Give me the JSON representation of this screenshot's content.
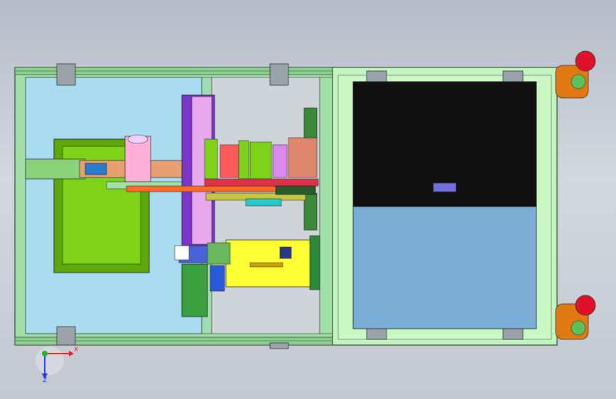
{
  "viewport": {
    "background_top": "#b6bcc8",
    "background_bottom": "#d3d7de"
  },
  "model": {
    "frame_color": "#9fe0a6",
    "base_plate_color": "#a9dcef",
    "tray_color": "#7ed31a",
    "column_color": "#7c35c8",
    "carriage_color": "#e9a7ee",
    "rail_color": "#ff6a2a",
    "gearbox_color": "#ffff33",
    "display_upper_color": "#111111",
    "display_lower_color": "#7aaed6",
    "display_button_color": "#7070dd",
    "cabinet_color": "#c3f5c0",
    "stack_light_color": "#e07a10",
    "stack_light_cap_color": "#e0102a"
  },
  "triad": {
    "x_label": "X",
    "z_label": "Z",
    "x_color": "#e0202a",
    "y_color": "#21b52b",
    "z_color": "#2040e0"
  }
}
